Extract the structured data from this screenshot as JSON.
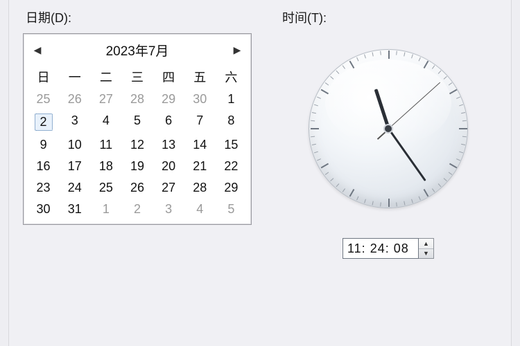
{
  "labels": {
    "date": "日期(D):",
    "time": "时间(T):"
  },
  "calendar": {
    "title": "2023年7月",
    "prev_icon": "◀",
    "next_icon": "▶",
    "dow": [
      "日",
      "一",
      "二",
      "三",
      "四",
      "五",
      "六"
    ],
    "selected_day": 2,
    "weeks": [
      [
        {
          "n": 25,
          "out": true
        },
        {
          "n": 26,
          "out": true
        },
        {
          "n": 27,
          "out": true
        },
        {
          "n": 28,
          "out": true
        },
        {
          "n": 29,
          "out": true
        },
        {
          "n": 30,
          "out": true
        },
        {
          "n": 1
        }
      ],
      [
        {
          "n": 2,
          "sel": true
        },
        {
          "n": 3
        },
        {
          "n": 4
        },
        {
          "n": 5
        },
        {
          "n": 6
        },
        {
          "n": 7
        },
        {
          "n": 8
        }
      ],
      [
        {
          "n": 9
        },
        {
          "n": 10
        },
        {
          "n": 11
        },
        {
          "n": 12
        },
        {
          "n": 13
        },
        {
          "n": 14
        },
        {
          "n": 15
        }
      ],
      [
        {
          "n": 16
        },
        {
          "n": 17
        },
        {
          "n": 18
        },
        {
          "n": 19
        },
        {
          "n": 20
        },
        {
          "n": 21
        },
        {
          "n": 22
        }
      ],
      [
        {
          "n": 23
        },
        {
          "n": 24
        },
        {
          "n": 25
        },
        {
          "n": 26
        },
        {
          "n": 27
        },
        {
          "n": 28
        },
        {
          "n": 29
        }
      ],
      [
        {
          "n": 30
        },
        {
          "n": 31
        },
        {
          "n": 1,
          "out": true
        },
        {
          "n": 2,
          "out": true
        },
        {
          "n": 3,
          "out": true
        },
        {
          "n": 4,
          "out": true
        },
        {
          "n": 5,
          "out": true
        }
      ]
    ]
  },
  "clock": {
    "hours": 11,
    "minutes": 24,
    "seconds": 8,
    "display": "11: 24: 08"
  },
  "spinner": {
    "up_icon": "▲",
    "down_icon": "▼"
  }
}
